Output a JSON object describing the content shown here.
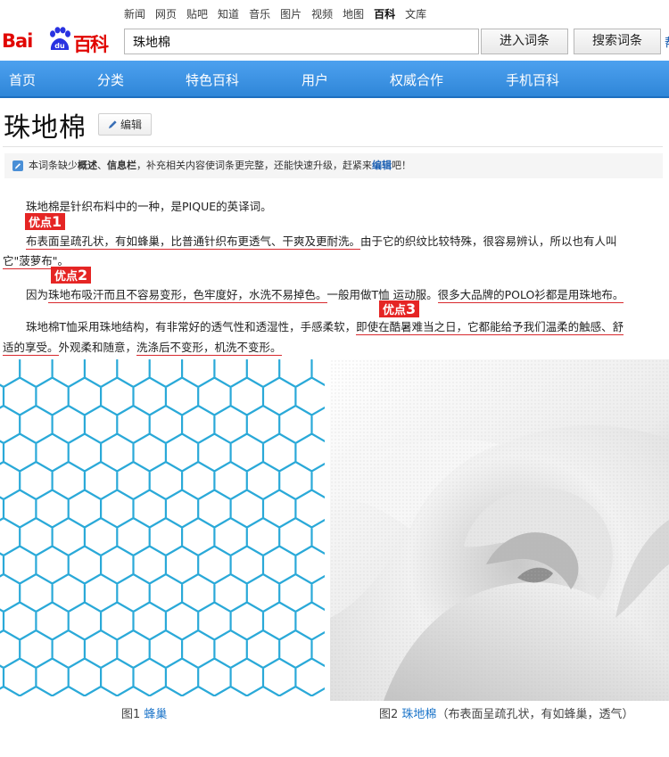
{
  "nav": {
    "links": [
      "新闻",
      "网页",
      "贴吧",
      "知道",
      "音乐",
      "图片",
      "视频",
      "地图",
      "百科",
      "文库"
    ],
    "active": "百科"
  },
  "logo": {
    "text_bai": "Bai",
    "text_du": "du",
    "text_baike": "百科"
  },
  "search": {
    "value": "珠地棉",
    "enter_label": "进入词条",
    "search_label": "搜索词条",
    "edge_link": "帮"
  },
  "menu": [
    "首页",
    "分类",
    "特色百科",
    "用户",
    "权威合作",
    "手机百科"
  ],
  "article": {
    "title": "珠地棉",
    "edit_label": "编辑",
    "notice": {
      "prefix": "本词条缺少",
      "bold1": "概述",
      "sep": "、",
      "bold2": "信息栏",
      "middle": "，补充相关内容使词条更完整，还能快速升级，赶紧来",
      "link": "编辑",
      "suffix": "吧！"
    },
    "p1": "珠地棉是针织布料中的一种，是PIQUE的英译词。",
    "tag_label": "优点",
    "tag1_num": "1",
    "tag2_num": "2",
    "tag3_num": "3",
    "p2_u": "布表面呈疏孔状，有如蜂巢，比普通针织布更透气、干爽及更耐洗。",
    "p2_rest": "由于它的织纹比较特殊，很容易辨认，所以也有人叫",
    "p2_line2": "它\"菠萝布\"。",
    "p3_a": "因为",
    "p3_u1": "珠地布吸汗而且不容易变形，色牢度好，水洗不易掉色。",
    "p3_b": "一般用做T恤 运动服。",
    "p3_u2": "很多大品牌的POLO衫都是用珠地布。",
    "p4_a": "珠地棉T恤采用珠地结构，有非常好的透气性和透湿性，手感柔软，",
    "p4_u": "即使在酷暑难当之日，它都能给予我们温柔的触感、舒",
    "p5_u": "适的享受。",
    "p5_b": "外观柔和随意，",
    "p5_u2": "洗涤后不变形，机洗不变形。"
  },
  "figures": {
    "fig1_label": "图1",
    "fig1_name": "蜂巢",
    "fig2_label": "图2",
    "fig2_name": "珠地棉",
    "fig2_desc": "（布表面呈疏孔状，有如蜂巢，透气）"
  },
  "colors": {
    "brand_red": "#e10602",
    "menu_blue": "#3a8fdf",
    "hex_line": "#2aa9d8",
    "underline": "#d8292e",
    "tag_red": "#e52524",
    "link_blue": "#1b74c9"
  }
}
